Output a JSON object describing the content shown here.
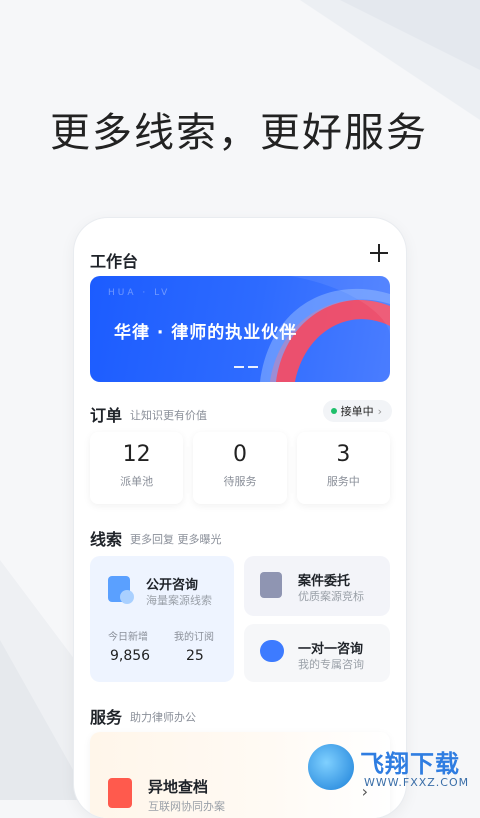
{
  "headline": "更多线索，更好服务",
  "workspace": {
    "title": "工作台"
  },
  "banner": {
    "tag": "HUA · LV",
    "title": "华律 · 律师的执业伙伴"
  },
  "orders": {
    "title": "订单",
    "subtitle": "让知识更有价值",
    "status": "接单中",
    "stats": [
      {
        "value": "12",
        "label": "派单池"
      },
      {
        "value": "0",
        "label": "待服务"
      },
      {
        "value": "3",
        "label": "服务中"
      }
    ]
  },
  "leads": {
    "title": "线索",
    "subtitle": "更多回复 更多曝光",
    "public_consult": {
      "title": "公开咨询",
      "subtitle": "海量案源线索",
      "today_label": "今日新增",
      "today_value": "9,856",
      "sub_label": "我的订阅",
      "sub_value": "25"
    },
    "case_entrust": {
      "title": "案件委托",
      "subtitle": "优质案源竞标"
    },
    "one_on_one": {
      "title": "一对一咨询",
      "subtitle": "我的专属咨询"
    }
  },
  "services": {
    "title": "服务",
    "subtitle": "助力律师办公",
    "item": {
      "title": "异地查档",
      "subtitle": "互联网协同办案"
    }
  },
  "watermark": {
    "cn": "飞翔下载",
    "en": "WWW.FXXZ.COM"
  },
  "colors": {
    "accent": "#1c5cff",
    "status_dot": "#1fbf6a",
    "service_icon": "#ff5a4d"
  }
}
